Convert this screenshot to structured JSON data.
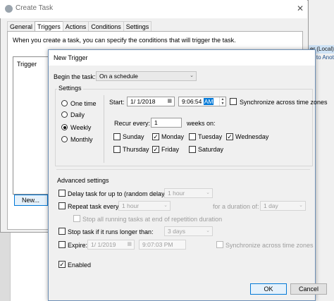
{
  "background": {
    "right_chip1": "er (Local)",
    "right_chip2": "ry to Anothe"
  },
  "create_task": {
    "title": "Create Task",
    "close_glyph": "✕",
    "tabs": [
      "General",
      "Triggers",
      "Actions",
      "Conditions",
      "Settings"
    ],
    "active_tab": "Triggers",
    "description": "When you create a task, you can specify the conditions that will trigger the task.",
    "list_header": "Trigger",
    "new_button": "New..."
  },
  "new_trigger": {
    "title": "New Trigger",
    "begin_label": "Begin the task:",
    "begin_value": "On a schedule",
    "settings_label": "Settings",
    "schedule_options": [
      "One time",
      "Daily",
      "Weekly",
      "Monthly"
    ],
    "schedule_selected": "Weekly",
    "start_label": "Start:",
    "start_date": "1/  1/2018",
    "start_time_main": "9:06:54 ",
    "start_time_sel": "AM",
    "sync_label": "Synchronize across time zones",
    "sync_checked": false,
    "recur_label": "Recur every:",
    "recur_value": "1",
    "weeks_label": "weeks on:",
    "days": [
      {
        "label": "Sunday",
        "checked": false
      },
      {
        "label": "Monday",
        "checked": true
      },
      {
        "label": "Tuesday",
        "checked": false
      },
      {
        "label": "Wednesday",
        "checked": true
      },
      {
        "label": "Thursday",
        "checked": false
      },
      {
        "label": "Friday",
        "checked": true
      },
      {
        "label": "Saturday",
        "checked": false
      }
    ],
    "advanced_label": "Advanced settings",
    "delay_label": "Delay task for up to (random delay):",
    "delay_value": "1 hour",
    "repeat_label": "Repeat task every:",
    "repeat_value": "1 hour",
    "duration_label": "for a duration of:",
    "duration_value": "1 day",
    "stop_all_label": "Stop all running tasks at end of repetition duration",
    "stop_longer_label": "Stop task if it runs longer than:",
    "stop_longer_value": "3 days",
    "expire_label": "Expire:",
    "expire_date": "1/  1/2019",
    "expire_time": "9:07:03 PM",
    "expire_sync_label": "Synchronize across time zones",
    "enabled_label": "Enabled",
    "enabled_checked": true,
    "ok_label": "OK",
    "cancel_label": "Cancel"
  },
  "icons": {
    "caret": "⌄",
    "calendar": "▦",
    "check": "✓",
    "spin_up": "▲",
    "spin_down": "▼"
  }
}
